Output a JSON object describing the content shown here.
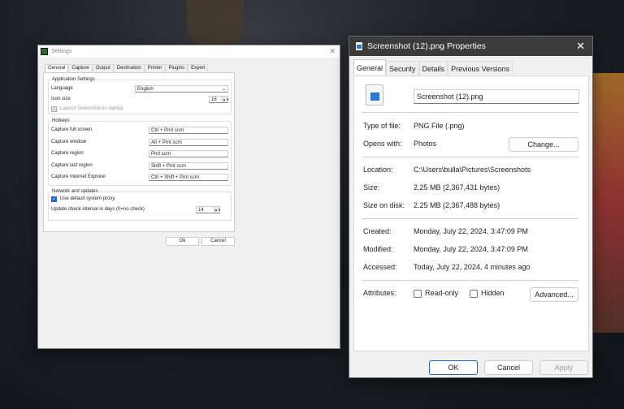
{
  "settings": {
    "title": "Settings",
    "tabs": [
      "General",
      "Capture",
      "Output",
      "Destination",
      "Printer",
      "Plugins",
      "Expert"
    ],
    "app": {
      "legend": "Application Settings",
      "language_label": "Language",
      "language_value": "English",
      "icon_size_label": "Icon size",
      "icon_size_value": "16",
      "launch_label": "Launch Greenshot on startup"
    },
    "hotkeys": {
      "legend": "Hotkeys",
      "rows": [
        {
          "label": "Capture full screen",
          "value": "Ctrl + Prnt scrn"
        },
        {
          "label": "Capture window",
          "value": "Alt + Prnt scrn"
        },
        {
          "label": "Capture region",
          "value": "Prnt scrn"
        },
        {
          "label": "Capture last region",
          "value": "Shift + Prnt scrn"
        },
        {
          "label": "Capture Internet Explorer",
          "value": "Ctrl + Shift + Prnt scrn"
        }
      ]
    },
    "network": {
      "legend": "Network and updates",
      "proxy_label": "Use default system proxy",
      "proxy_checked": true,
      "interval_label": "Update check interval in days (0=no check)",
      "interval_value": "14"
    },
    "ok": "Ok",
    "cancel": "Cancel"
  },
  "props": {
    "title": "Screenshot (12).png Properties",
    "tabs": [
      "General",
      "Security",
      "Details",
      "Previous Versions"
    ],
    "filename": "Screenshot (12).png",
    "type_label": "Type of file:",
    "type_value": "PNG File (.png)",
    "opens_label": "Opens with:",
    "opens_value": "Photos",
    "change": "Change...",
    "location_label": "Location:",
    "location_value": "C:\\Users\\bulla\\Pictures\\Screenshots",
    "size_label": "Size:",
    "size_value": "2.25 MB (2,367,431 bytes)",
    "disk_label": "Size on disk:",
    "disk_value": "2.25 MB (2,367,488 bytes)",
    "created_label": "Created:",
    "created_value": "Monday, July 22, 2024, 3:47:09 PM",
    "modified_label": "Modified:",
    "modified_value": "Monday, July 22, 2024, 3:47:09 PM",
    "accessed_label": "Accessed:",
    "accessed_value": "Today, July 22, 2024, 4 minutes ago",
    "attributes_label": "Attributes:",
    "readonly": "Read-only",
    "hidden": "Hidden",
    "advanced": "Advanced...",
    "ok": "OK",
    "cancel": "Cancel",
    "apply": "Apply"
  }
}
